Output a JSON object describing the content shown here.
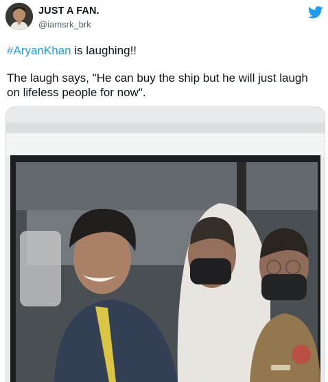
{
  "tweet": {
    "author_name": "JUST A FAN.",
    "author_handle": "@iamsrk_brk",
    "hashtag": "#AryanKhan",
    "line1_rest": " is laughing!!",
    "line2": "The laugh says, \"He can buy the ship but he will just laugh on lifeless people for now\"."
  },
  "icons": {
    "platform": "twitter-bird-icon"
  },
  "colors": {
    "link": "#1d9bf0",
    "handle": "#536471",
    "twitter_blue": "#1d9bf0"
  }
}
